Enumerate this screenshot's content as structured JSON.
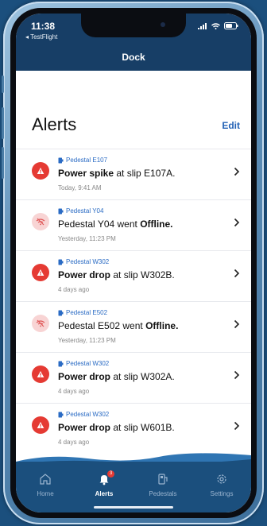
{
  "status_bar": {
    "time": "11:38",
    "back_app": "◂ TestFlight"
  },
  "navbar": {
    "title": "Dock"
  },
  "header": {
    "title": "Alerts",
    "edit_label": "Edit"
  },
  "alerts": [
    {
      "type": "power",
      "icon": "alert-triangle-icon",
      "pedestal": "Pedestal E107",
      "msg_pre": "Power spike",
      "msg_post": " at slip E107A.",
      "time": "Today, 9:41 AM"
    },
    {
      "type": "offline",
      "icon": "wifi-off-icon",
      "pedestal": "Pedestal Y04",
      "msg_pre": "Pedestal Y04 went ",
      "msg_post": "Offline.",
      "time": "Yesterday, 11:23 PM"
    },
    {
      "type": "power",
      "icon": "alert-triangle-icon",
      "pedestal": "Pedestal W302",
      "msg_pre": "Power drop",
      "msg_post": " at slip W302B.",
      "time": "4 days ago"
    },
    {
      "type": "offline",
      "icon": "wifi-off-icon",
      "pedestal": "Pedestal E502",
      "msg_pre": "Pedestal E502 went ",
      "msg_post": "Offline.",
      "time": "Yesterday, 11:23 PM"
    },
    {
      "type": "power",
      "icon": "alert-triangle-icon",
      "pedestal": "Pedestal W302",
      "msg_pre": "Power drop",
      "msg_post": " at slip W302A.",
      "time": "4 days ago"
    },
    {
      "type": "power",
      "icon": "alert-triangle-icon",
      "pedestal": "Pedestal W302",
      "msg_pre": "Power drop",
      "msg_post": " at slip W601B.",
      "time": "4 days ago"
    }
  ],
  "tabbar": {
    "tabs": [
      {
        "label": "Home",
        "icon": "home-icon"
      },
      {
        "label": "Alerts",
        "icon": "bell-icon",
        "badge": "3"
      },
      {
        "label": "Pedestals",
        "icon": "pedestal-icon"
      },
      {
        "label": "Settings",
        "icon": "gear-icon"
      }
    ]
  },
  "colors": {
    "navbar": "#173e66",
    "accent": "#2563b6",
    "alert_red": "#e53a33",
    "offline_pink": "#f8d4d4",
    "tabbar": "#1b4f7d"
  }
}
